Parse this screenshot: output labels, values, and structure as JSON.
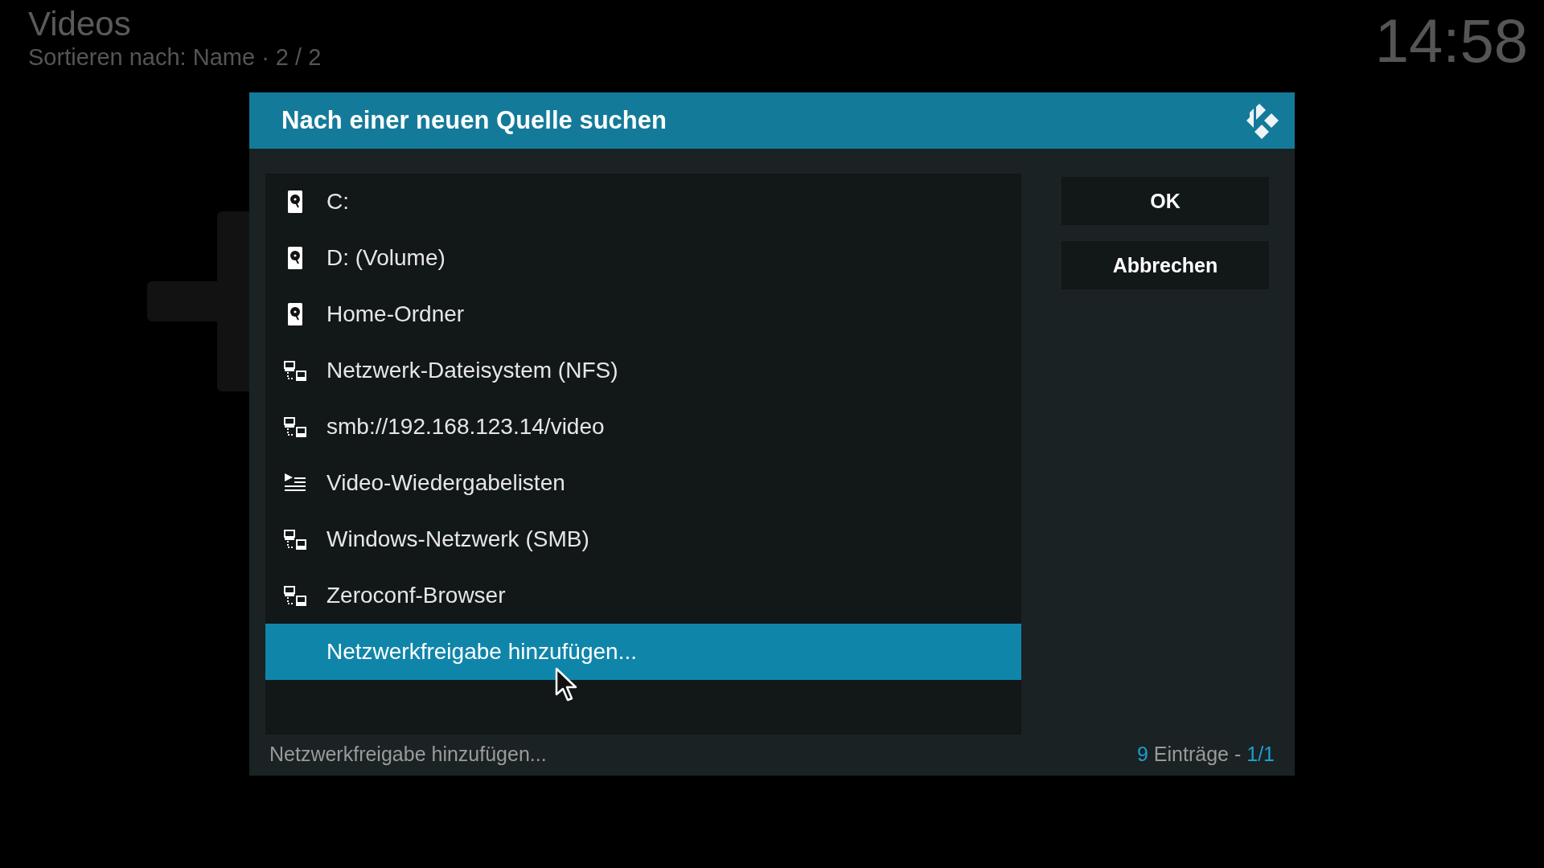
{
  "screen": {
    "title": "Videos",
    "subtitle": "Sortieren nach: Name  ·  2 / 2",
    "clock": "14:58"
  },
  "dialog": {
    "title": "Nach einer neuen Quelle suchen",
    "items": [
      {
        "kind": "drive",
        "label": "C:",
        "selected": false
      },
      {
        "kind": "drive",
        "label": "D: (Volume)",
        "selected": false
      },
      {
        "kind": "drive",
        "label": "Home-Ordner",
        "selected": false
      },
      {
        "kind": "network",
        "label": "Netzwerk-Dateisystem (NFS)",
        "selected": false
      },
      {
        "kind": "network",
        "label": "smb://192.168.123.14/video",
        "selected": false
      },
      {
        "kind": "playlist",
        "label": "Video-Wiedergabelisten",
        "selected": false
      },
      {
        "kind": "network",
        "label": "Windows-Netzwerk (SMB)",
        "selected": false
      },
      {
        "kind": "network",
        "label": "Zeroconf-Browser",
        "selected": false
      },
      {
        "kind": "none",
        "label": "Netzwerkfreigabe hinzufügen...",
        "selected": true
      }
    ],
    "buttons": [
      "OK",
      "Abbrechen"
    ],
    "status": {
      "description": "Netzwerkfreigabe hinzufügen...",
      "count": "9",
      "count_label": "Einträge -",
      "page": "1/1"
    }
  }
}
